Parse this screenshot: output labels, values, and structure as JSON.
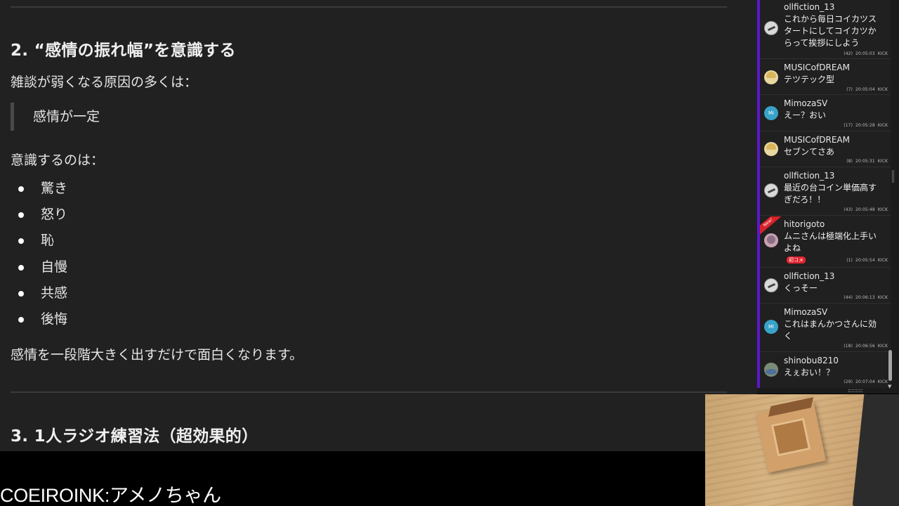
{
  "article": {
    "section2_heading": "2. “感情の振れ幅”を意識する",
    "intro_text": "雑談が弱くなる原因の多くは：",
    "quote_text": "感情が一定",
    "focus_text": "意識するのは：",
    "emotions": [
      "驚き",
      "怒り",
      "恥",
      "自慢",
      "共感",
      "後悔"
    ],
    "conclusion_text": "感情を一段階大きく出すだけで面白くなります。",
    "section3_heading": "3. 1人ラジオ練習法（超効果的）"
  },
  "chat": {
    "messages": [
      {
        "user": "ollfiction_13",
        "text": "これから毎日コイカツスタートにしてコイカツからって挨拶にしよう",
        "count": "(42)",
        "time": "20:05:03",
        "source": "KICK",
        "avatar": "ollfiction-avatar"
      },
      {
        "user": "MUSICofDREAM",
        "text": "テツテック型",
        "count": "(7)",
        "time": "20:05:04",
        "source": "KICK",
        "avatar": "musicofdream-avatar"
      },
      {
        "user": "MimozaSV",
        "text": "えー？おい",
        "count": "(17)",
        "time": "20:05:28",
        "source": "KICK",
        "avatar": "mimozasv-avatar",
        "avatar_text": "Mi"
      },
      {
        "user": "MUSICofDREAM",
        "text": "セブンてさあ",
        "count": "(8)",
        "time": "20:05:31",
        "source": "KICK",
        "avatar": "musicofdream-avatar"
      },
      {
        "user": "ollfiction_13",
        "text": "最近の台コイン単価高すぎだろ！！",
        "count": "(43)",
        "time": "20:05:48",
        "source": "KICK",
        "avatar": "ollfiction-avatar"
      },
      {
        "user": "hitorigoto",
        "text": "ムニさんは極端化上手いよね",
        "count": "(1)",
        "time": "20:05:54",
        "source": "KICK",
        "avatar": "hitorigoto-avatar",
        "badge": "初コメ",
        "ribbon": "New!"
      },
      {
        "user": "ollfiction_13",
        "text": "くっそー",
        "count": "(44)",
        "time": "20:06:13",
        "source": "KICK",
        "avatar": "ollfiction-avatar"
      },
      {
        "user": "MimozaSV",
        "text": "これはまんかつさんに効く",
        "count": "(18)",
        "time": "20:06:56",
        "source": "KICK",
        "avatar": "mimozasv-avatar",
        "avatar_text": "Mi"
      },
      {
        "user": "shinobu8210",
        "text": "えぇおい！？",
        "count": "(29)",
        "time": "20:07:04",
        "source": "KICK",
        "avatar": "shinobu-avatar"
      }
    ]
  },
  "caption": {
    "text": "COEIROINK:アメノちゃん"
  },
  "colors": {
    "article_bg": "#212121",
    "chat_accent": "#5b18c9",
    "badge_red": "#e0242f"
  }
}
